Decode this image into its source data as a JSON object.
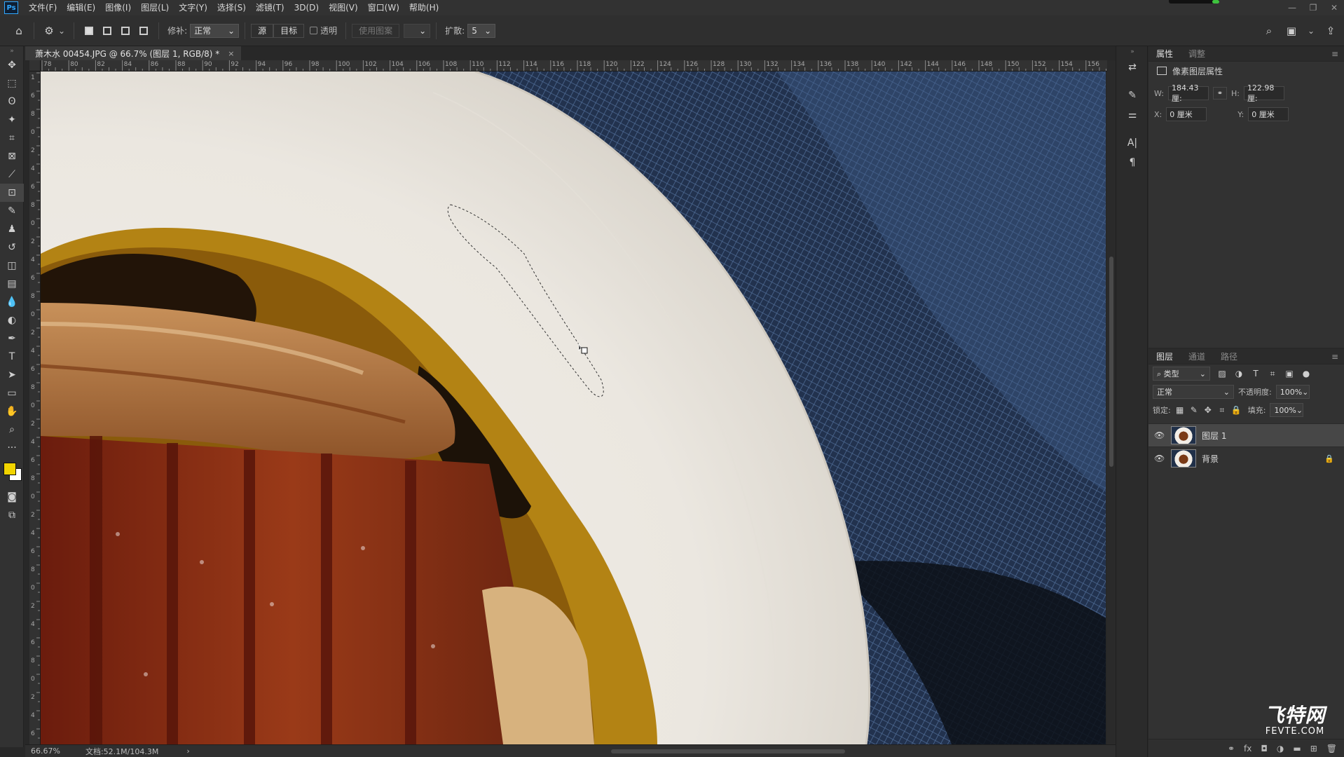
{
  "app": {
    "logo": "Ps"
  },
  "menu": [
    "文件(F)",
    "编辑(E)",
    "图像(I)",
    "图层(L)",
    "文字(Y)",
    "选择(S)",
    "滤镜(T)",
    "3D(D)",
    "视图(V)",
    "窗口(W)",
    "帮助(H)"
  ],
  "options": {
    "patch_label": "修补:",
    "patch_mode": "正常",
    "source_btn": "源",
    "target_btn": "目标",
    "transparent_label": "透明",
    "use_pattern_btn": "使用图案",
    "diffusion_label": "扩散:",
    "diffusion_value": "5"
  },
  "document": {
    "tab_title": "萧木水 00454.JPG @ 66.7% (图层 1, RGB/8) *",
    "close": "×"
  },
  "ruler": {
    "h_ticks": [
      "78",
      "80",
      "82",
      "84",
      "86",
      "88",
      "90",
      "92",
      "94",
      "96",
      "98",
      "100",
      "102",
      "104",
      "106",
      "108",
      "110",
      "112",
      "114",
      "116",
      "118",
      "120",
      "122",
      "124",
      "126",
      "128",
      "130",
      "132",
      "134",
      "136",
      "138",
      "140",
      "142",
      "144",
      "146",
      "148",
      "150",
      "152",
      "154",
      "156"
    ],
    "v_ticks": [
      "1",
      "6",
      "8",
      "0",
      "2",
      "4",
      "6",
      "8",
      "0",
      "2",
      "4",
      "6",
      "8",
      "0",
      "2",
      "4",
      "6",
      "8",
      "0",
      "2",
      "4",
      "6",
      "8",
      "0",
      "2",
      "4",
      "6",
      "8",
      "0",
      "2",
      "4",
      "6",
      "8",
      "0",
      "2",
      "4",
      "6"
    ]
  },
  "status": {
    "zoom": "66.67%",
    "doc_size": "文档:52.1M/104.3M",
    "arrow": "›"
  },
  "properties": {
    "tabs": [
      "属性",
      "调整"
    ],
    "title": "像素图层属性",
    "w_label": "W:",
    "w_value": "184.43 厘:",
    "h_label": "H:",
    "h_value": "122.98 厘:",
    "x_label": "X:",
    "x_value": "0 厘米",
    "y_label": "Y:",
    "y_value": "0 厘米"
  },
  "layers": {
    "tabs": [
      "图层",
      "通道",
      "路径"
    ],
    "filter_kind": "类型",
    "blend_mode": "正常",
    "opacity_label": "不透明度:",
    "opacity_value": "100%",
    "lock_label": "锁定:",
    "fill_label": "填充:",
    "fill_value": "100%",
    "items": [
      {
        "name": "图层 1",
        "selected": true
      },
      {
        "name": "背景",
        "locked": true
      }
    ]
  },
  "watermark": {
    "big": "飞特网",
    "small": "FEVTE.COM"
  },
  "colors": {
    "foreground": "#f2d400",
    "background": "#ffffff",
    "accent": "#31a8ff"
  }
}
